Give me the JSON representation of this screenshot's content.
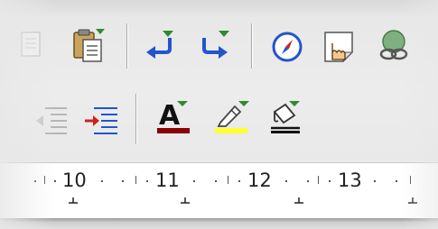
{
  "toolbar_top": {
    "icons": [
      "copy-icon",
      "paste-icon",
      "undo-icon",
      "redo-icon",
      "navigator-icon",
      "hyperlink-icon",
      "link-icon"
    ]
  },
  "toolbar_format": {
    "icons": [
      "decrease-indent-icon",
      "increase-indent-icon",
      "font-color-icon",
      "highlighting-icon",
      "paragraph-background-icon"
    ],
    "font_color_glyph": "A",
    "colors": {
      "font_color": "#8b0000",
      "highlight": "#ffff33",
      "background": "#000000",
      "dropdown_arrow": "#2e8b2e",
      "undo_redo": "#2255cc"
    }
  },
  "ruler": {
    "labels": [
      "10",
      "11",
      "12",
      "13"
    ]
  }
}
